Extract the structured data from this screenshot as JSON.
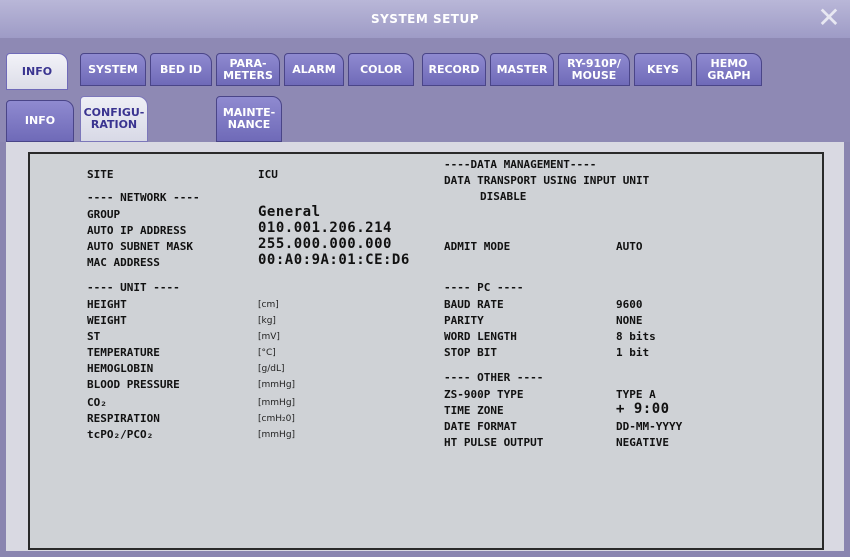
{
  "window": {
    "title": "SYSTEM SETUP",
    "close_glyph": "✕"
  },
  "tabs_main": [
    {
      "label": "INFO"
    },
    {
      "label": "SYSTEM"
    },
    {
      "label": "BED ID"
    },
    {
      "label": "PARA-\nMETERS"
    },
    {
      "label": "ALARM"
    },
    {
      "label": "COLOR"
    },
    {
      "label": "RECORD"
    },
    {
      "label": "MASTER"
    },
    {
      "label": "RY-910P/\nMOUSE"
    },
    {
      "label": "KEYS"
    },
    {
      "label": "HEMO\nGRAPH"
    }
  ],
  "tabs_sub": [
    {
      "label": "INFO"
    },
    {
      "label": "CONFIGU-\nRATION"
    },
    {
      "label": "MAINTE-\nNANCE"
    }
  ],
  "left": {
    "site_label": "SITE",
    "site_value": "ICU",
    "network_header": "---- NETWORK ----",
    "group_label": "GROUP",
    "group_value": "General",
    "ip_label": "AUTO IP ADDRESS",
    "ip_value": "010.001.206.214",
    "subnet_label": "AUTO SUBNET MASK",
    "subnet_value": "255.000.000.000",
    "mac_label": "MAC ADDRESS",
    "mac_value": "00:A0:9A:01:CE:D6",
    "unit_header": "---- UNIT ----",
    "units": [
      {
        "label": "HEIGHT",
        "value": "[cm]"
      },
      {
        "label": "WEIGHT",
        "value": "[kg]"
      },
      {
        "label": "ST",
        "value": "[mV]"
      },
      {
        "label": "TEMPERATURE",
        "value": "[°C]"
      },
      {
        "label": "HEMOGLOBIN",
        "value": "[g/dL]"
      },
      {
        "label": "BLOOD PRESSURE",
        "value": "[mmHg]"
      },
      {
        "label": "CO₂",
        "value": "[mmHg]"
      },
      {
        "label": "RESPIRATION",
        "value": "[cmH₂0]"
      },
      {
        "label": "tcPO₂/PCO₂",
        "value": "[mmHg]"
      }
    ]
  },
  "right": {
    "data_mgmt_header": "----DATA MANAGEMENT----",
    "data_transport_label": "DATA TRANSPORT USING INPUT UNIT",
    "data_transport_value": "DISABLE",
    "admit_label": "ADMIT MODE",
    "admit_value": "AUTO",
    "pc_header": "---- PC ----",
    "pc": [
      {
        "label": "BAUD RATE",
        "value": "9600"
      },
      {
        "label": "PARITY",
        "value": "NONE"
      },
      {
        "label": "WORD LENGTH",
        "value": "8 bits"
      },
      {
        "label": "STOP BIT",
        "value": "1 bit"
      }
    ],
    "other_header": "---- OTHER ----",
    "other": [
      {
        "label": "ZS-900P TYPE",
        "value": "TYPE A"
      },
      {
        "label": "TIME ZONE",
        "value": "+  9:00"
      },
      {
        "label": "DATE FORMAT",
        "value": "DD-MM-YYYY"
      },
      {
        "label": "HT PULSE OUTPUT",
        "value": "NEGATIVE"
      }
    ]
  },
  "colors": {
    "title_bar": "#9e9bc6",
    "tab_fill": "#6f6ab8",
    "panel_bg": "#cfd2d6",
    "text": "#111111"
  }
}
